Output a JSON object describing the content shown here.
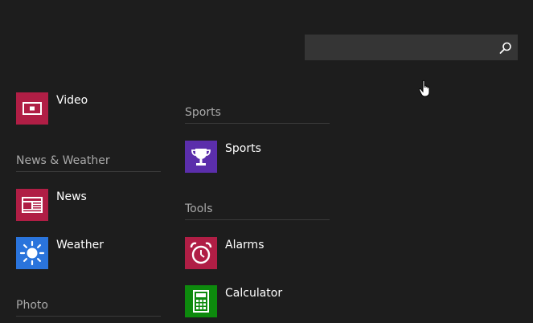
{
  "colors": {
    "background": "#1d1d1d",
    "search_bg": "#353535",
    "header_text": "#a9a9a9",
    "rule": "#3a3a3a",
    "video_tile": "#b01e45",
    "news_tile": "#b01e45",
    "weather_tile": "#2a74dc",
    "sports_tile": "#5b2eab",
    "alarms_tile": "#b01e45",
    "calculator_tile": "#0d8a0d"
  },
  "search": {
    "value": "",
    "placeholder": "",
    "icon": "search-icon"
  },
  "groups": {
    "news_weather": {
      "label": "News & Weather"
    },
    "photo": {
      "label": "Photo"
    },
    "sports": {
      "label": "Sports"
    },
    "tools": {
      "label": "Tools"
    }
  },
  "apps": {
    "video": {
      "label": "Video",
      "icon": "video-icon"
    },
    "news": {
      "label": "News",
      "icon": "newspaper-icon"
    },
    "weather": {
      "label": "Weather",
      "icon": "sun-icon"
    },
    "sports": {
      "label": "Sports",
      "icon": "trophy-icon"
    },
    "alarms": {
      "label": "Alarms",
      "icon": "alarm-clock-icon"
    },
    "calculator": {
      "label": "Calculator",
      "icon": "calculator-icon"
    }
  }
}
